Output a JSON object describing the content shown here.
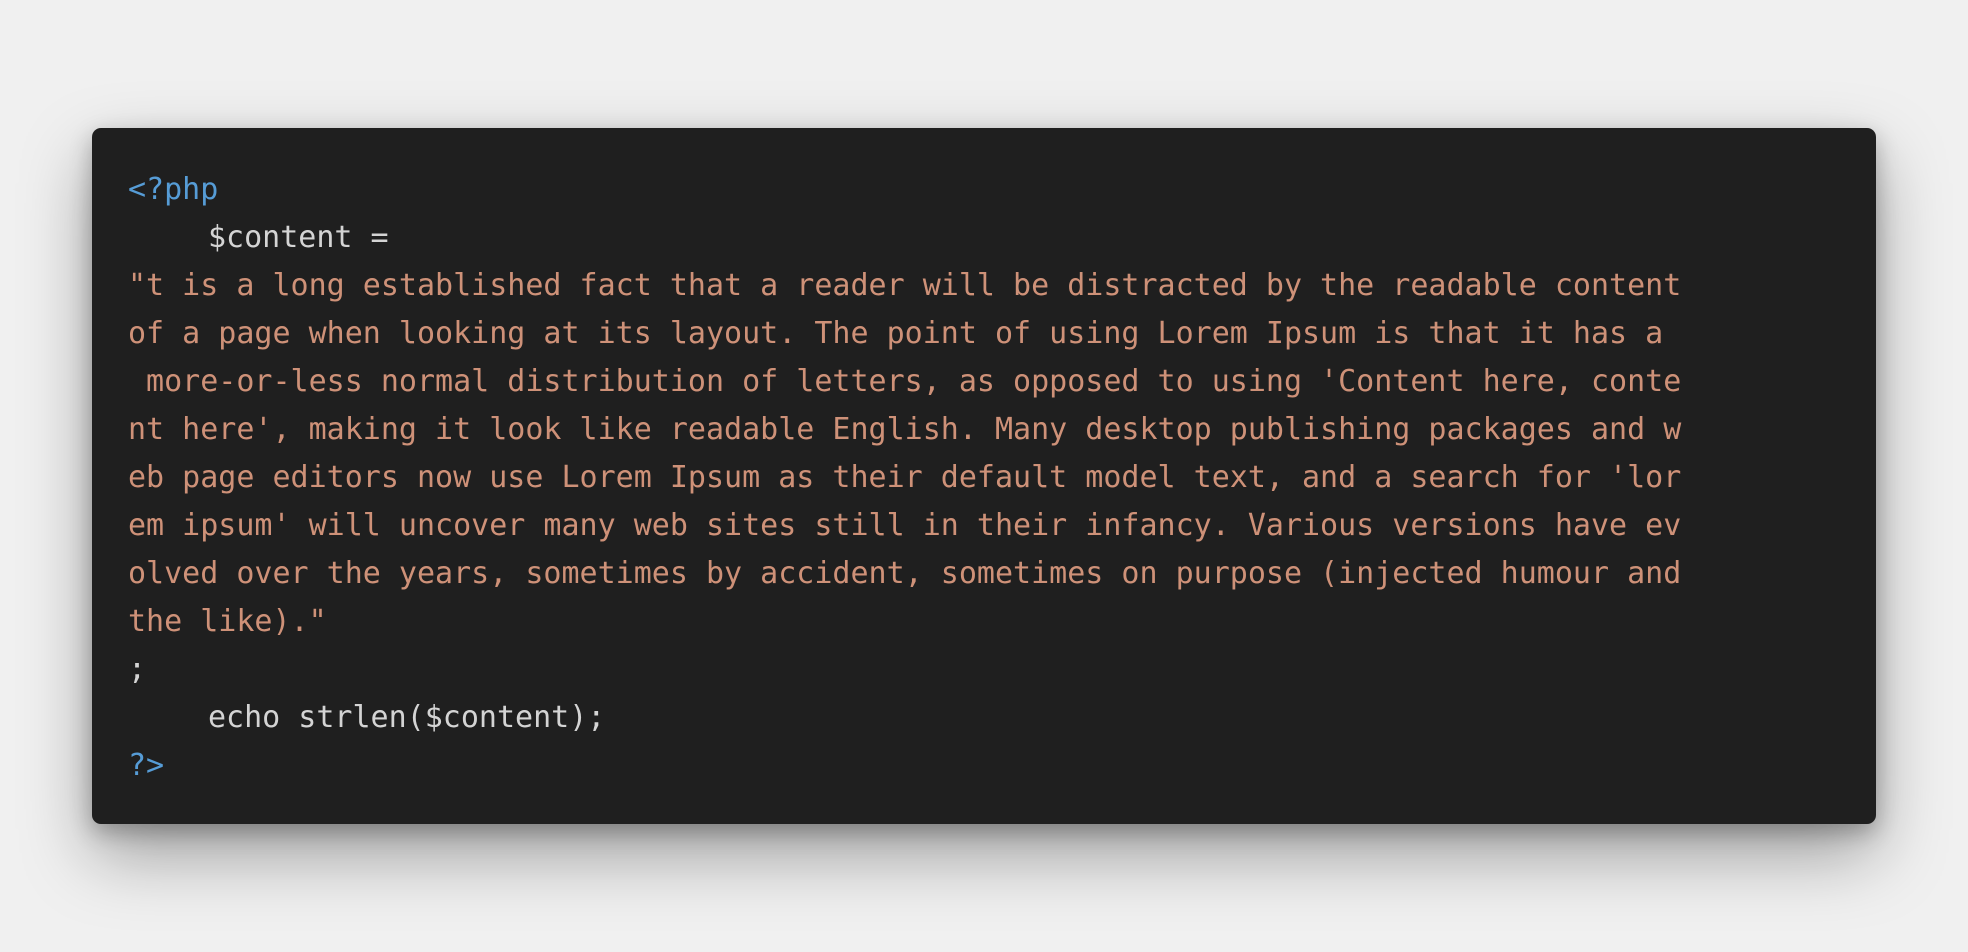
{
  "code": {
    "open_tag": "<?php",
    "assign_line": "$content =",
    "string_lines": [
      "\"t is a long established fact that a reader will be distracted by the readable content",
      "of a page when looking at its layout. The point of using Lorem Ipsum is that it has a",
      " more-or-less normal distribution of letters, as opposed to using 'Content here, conte",
      "nt here', making it look like readable English. Many desktop publishing packages and w",
      "eb page editors now use Lorem Ipsum as their default model text, and a search for 'lor",
      "em ipsum' will uncover many web sites still in their infancy. Various versions have ev",
      "olved over the years, sometimes by accident, sometimes on purpose (injected humour and",
      "the like).\""
    ],
    "semicolon_line": ";",
    "echo_line": "echo strlen($content);",
    "close_tag": "?>"
  },
  "colors": {
    "background": "#f0f0f0",
    "card": "#1f1f1f",
    "tag": "#569cd6",
    "plain": "#d4d4d4",
    "string": "#ce9178"
  }
}
